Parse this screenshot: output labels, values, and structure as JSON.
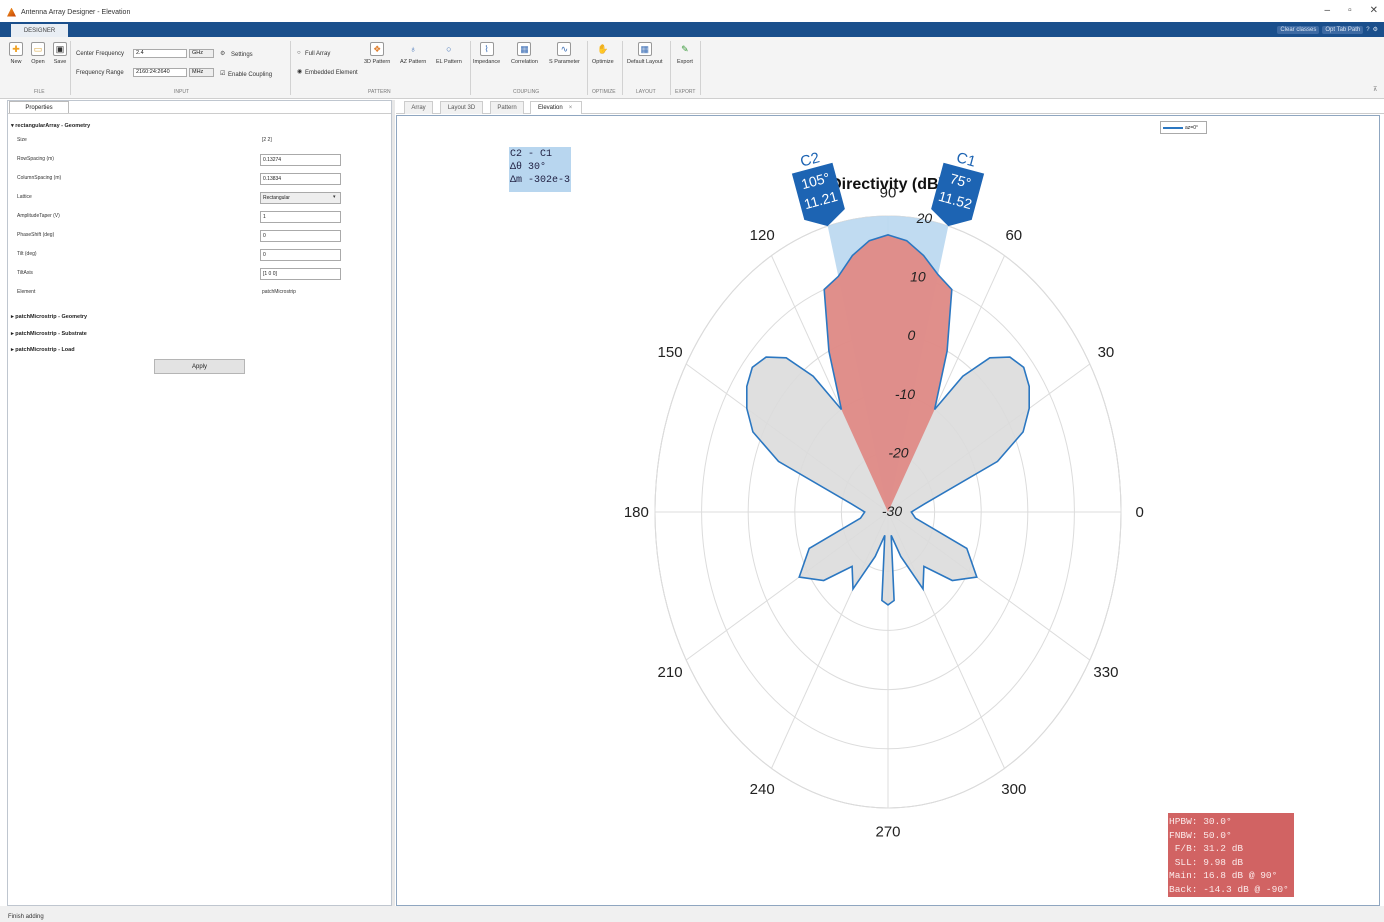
{
  "window": {
    "title": "Antenna Array Designer - Elevation"
  },
  "tabs": {
    "designer": "DESIGNER"
  },
  "quick_access": {
    "clear_cursors": "Clear classes",
    "opt_tab_path": "Opt Tab Path"
  },
  "toolstrip": {
    "file": {
      "new": "New",
      "open": "Open",
      "save": "Save",
      "section": "FILE"
    },
    "input": {
      "center_frequency_label": "Center Frequency",
      "center_frequency_value": "2.4",
      "center_frequency_unit": "GHz",
      "frequency_range_label": "Frequency Range",
      "frequency_range_value": "2160:24:2640",
      "frequency_range_unit": "MHz",
      "settings": "Settings",
      "enable_coupling": "Enable Coupling",
      "section": "INPUT"
    },
    "pattern": {
      "full_array": "Full Array",
      "embedded_element": "Embedded Element",
      "pattern_3d": "3D Pattern",
      "az_pattern": "AZ Pattern",
      "el_pattern": "EL Pattern",
      "section": "PATTERN"
    },
    "coupling": {
      "impedance": "Impedance",
      "correlation": "Correlation",
      "s_parameter": "S Parameter",
      "section": "COUPLING"
    },
    "optimize": {
      "optimize": "Optimize",
      "section": "OPTIMIZE"
    },
    "layout": {
      "default_layout": "Default Layout",
      "section": "LAYOUT"
    },
    "export": {
      "export": "Export",
      "section": "EXPORT"
    }
  },
  "properties": {
    "tab": "Properties",
    "group_geometry": "rectangularArray - Geometry",
    "rows": [
      {
        "label": "Size",
        "value": "[2 2]",
        "static": true
      },
      {
        "label": "RowSpacing (m)",
        "value": "0.13274"
      },
      {
        "label": "ColumnSpacing (m)",
        "value": "0.13834"
      },
      {
        "label": "Lattice",
        "value": "Rectangular",
        "dropdown": true
      },
      {
        "label": "AmplitudeTaper (V)",
        "value": "1"
      },
      {
        "label": "PhaseShift (deg)",
        "value": "0"
      },
      {
        "label": "Tilt (deg)",
        "value": "0"
      },
      {
        "label": "TiltAxis",
        "value": "[1 0 0]"
      },
      {
        "label": "Element",
        "value": "patchMicrostrip",
        "static": true
      }
    ],
    "collapsed_groups": [
      "patchMicrostrip - Geometry",
      "patchMicrostrip - Substrate",
      "patchMicrostrip - Load"
    ],
    "apply": "Apply"
  },
  "doc_tabs": [
    "Array",
    "Layout 3D",
    "Pattern",
    "Elevation"
  ],
  "active_doc_tab": "Elevation",
  "plot": {
    "legend": "az=0°",
    "title": "Directivity (dB)",
    "angle_labels": [
      "0",
      "30",
      "60",
      "90",
      "120",
      "150",
      "180",
      "210",
      "240",
      "270",
      "300",
      "330"
    ],
    "radial_labels": [
      "20",
      "10",
      "0",
      "-10",
      "-20",
      "-30"
    ],
    "cursor_c1": {
      "name": "C1",
      "angle": "75°",
      "value": "11.52"
    },
    "cursor_c2": {
      "name": "C2",
      "angle": "105°",
      "value": "11.21"
    },
    "delta_box": "C2 - C1\nΔθ 30°\nΔm -302e-3",
    "stats_box": "HPBW: 30.0°\nFNBW: 50.0°\n F/B: 31.2 dB\n SLL: 9.98 dB\nMain: 16.8 dB @ 90°\nBack: -14.3 dB @ -90°"
  },
  "chart_data": {
    "type": "polar",
    "title": "Directivity (dB)",
    "rlim": [
      -30,
      20
    ],
    "series": [
      {
        "name": "az=0°",
        "theta_deg": [
          0,
          10,
          20,
          25,
          30,
          35,
          40,
          45,
          50,
          55,
          60,
          65,
          70,
          75,
          80,
          85,
          90,
          95,
          100,
          105,
          110,
          115,
          120,
          125,
          130,
          135,
          140,
          145,
          150,
          155,
          160,
          170,
          180,
          190,
          200,
          210,
          220,
          230,
          240,
          250,
          260,
          265,
          270,
          275,
          280,
          290,
          300,
          310,
          320,
          330,
          340,
          350
        ],
        "directivity_db": [
          -25,
          -22,
          -5,
          2,
          5,
          7,
          8,
          7,
          4,
          -2,
          -10,
          0,
          10,
          11.5,
          14,
          16,
          16.8,
          16,
          14,
          11.2,
          10,
          0,
          -10,
          -2,
          4,
          7,
          8,
          7,
          5,
          2,
          -5,
          -22,
          -25,
          -24,
          -12,
          -8,
          -12,
          -18,
          -15,
          -22,
          -26,
          -15,
          -14.3,
          -15,
          -26,
          -22,
          -15,
          -18,
          -12,
          -8,
          -12,
          -24
        ]
      }
    ],
    "cursors": [
      {
        "name": "C1",
        "theta_deg": 75,
        "value": 11.52
      },
      {
        "name": "C2",
        "theta_deg": 105,
        "value": 11.21
      }
    ]
  }
}
